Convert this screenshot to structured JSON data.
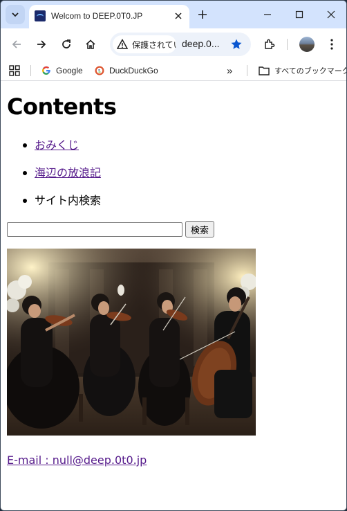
{
  "browser": {
    "tab_title": "Welcom to DEEP.0T0.JP",
    "security_label": "保護されてい",
    "url": "deep.0...",
    "bookmarks": [
      {
        "label": "Google",
        "icon": "google-icon"
      },
      {
        "label": "DuckDuckGo",
        "icon": "duckduckgo-icon"
      }
    ],
    "all_bookmarks_label": "すべてのブックマーク",
    "overflow_glyph": "»"
  },
  "page": {
    "title": "Contents",
    "nav": [
      {
        "label": "おみくじ",
        "link": true
      },
      {
        "label": "海辺の放浪記",
        "link": true
      },
      {
        "label": "サイト内検索",
        "link": false
      }
    ],
    "search": {
      "value": "",
      "button_label": "検索"
    },
    "email": "E-mail : null@deep.0t0.jp"
  },
  "colors": {
    "tabbar_bg": "#d3e3fd",
    "omnibox_bg": "#edf2fa",
    "star_color": "#0b57d0",
    "visited_link": "#551a8b"
  }
}
